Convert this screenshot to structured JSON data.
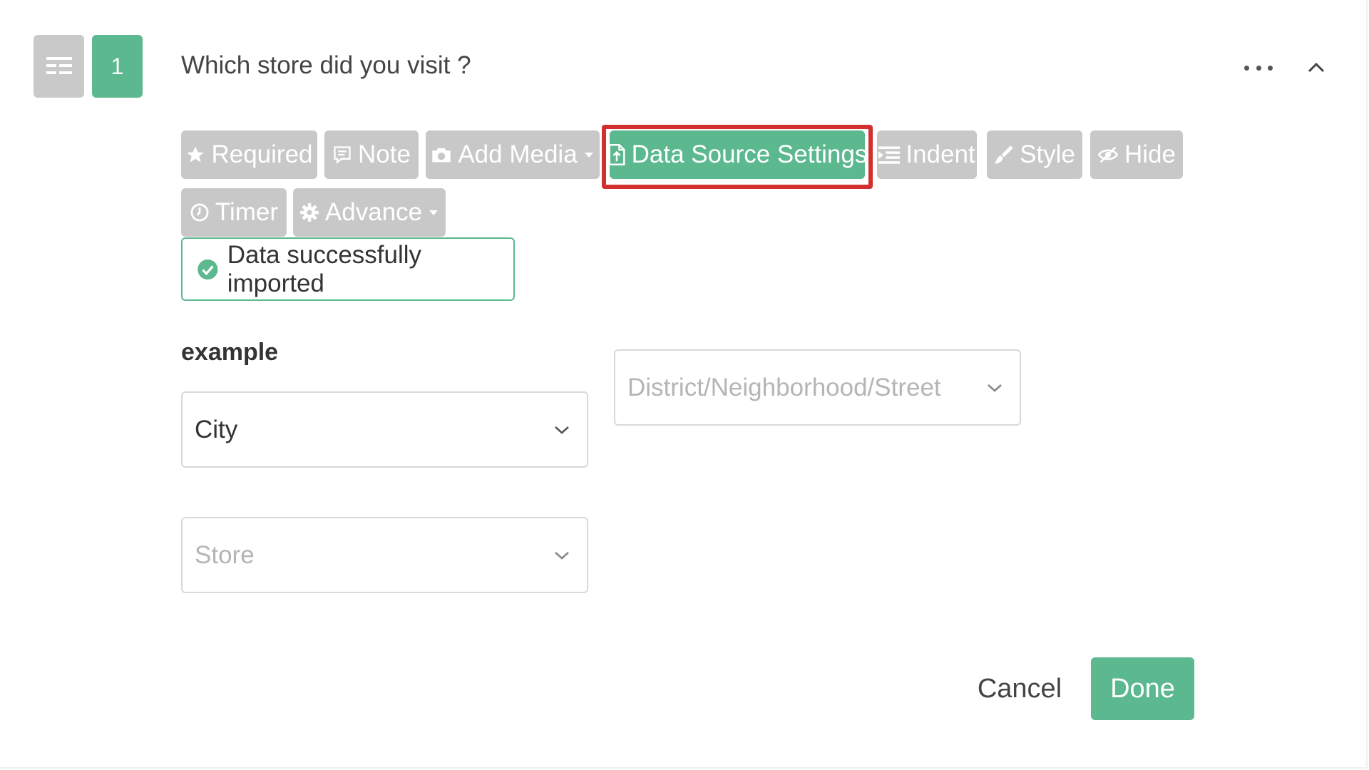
{
  "question": {
    "number": "1",
    "title": "Which store did you visit ?"
  },
  "toolbar": {
    "required": "Required",
    "note": "Note",
    "add_media": "Add Media",
    "data_source": "Data Source Settings",
    "indent": "Indent",
    "style": "Style",
    "hide": "Hide",
    "timer": "Timer",
    "advance": "Advance"
  },
  "status": {
    "message": "Data successfully imported"
  },
  "field": {
    "label": "example",
    "city": "City",
    "district": "District/Neighborhood/Street",
    "store": "Store"
  },
  "actions": {
    "cancel": "Cancel",
    "done": "Done"
  },
  "colors": {
    "accent": "#5cb88f",
    "tool_gray": "#c8c8c8",
    "highlight": "#d32f2f"
  }
}
